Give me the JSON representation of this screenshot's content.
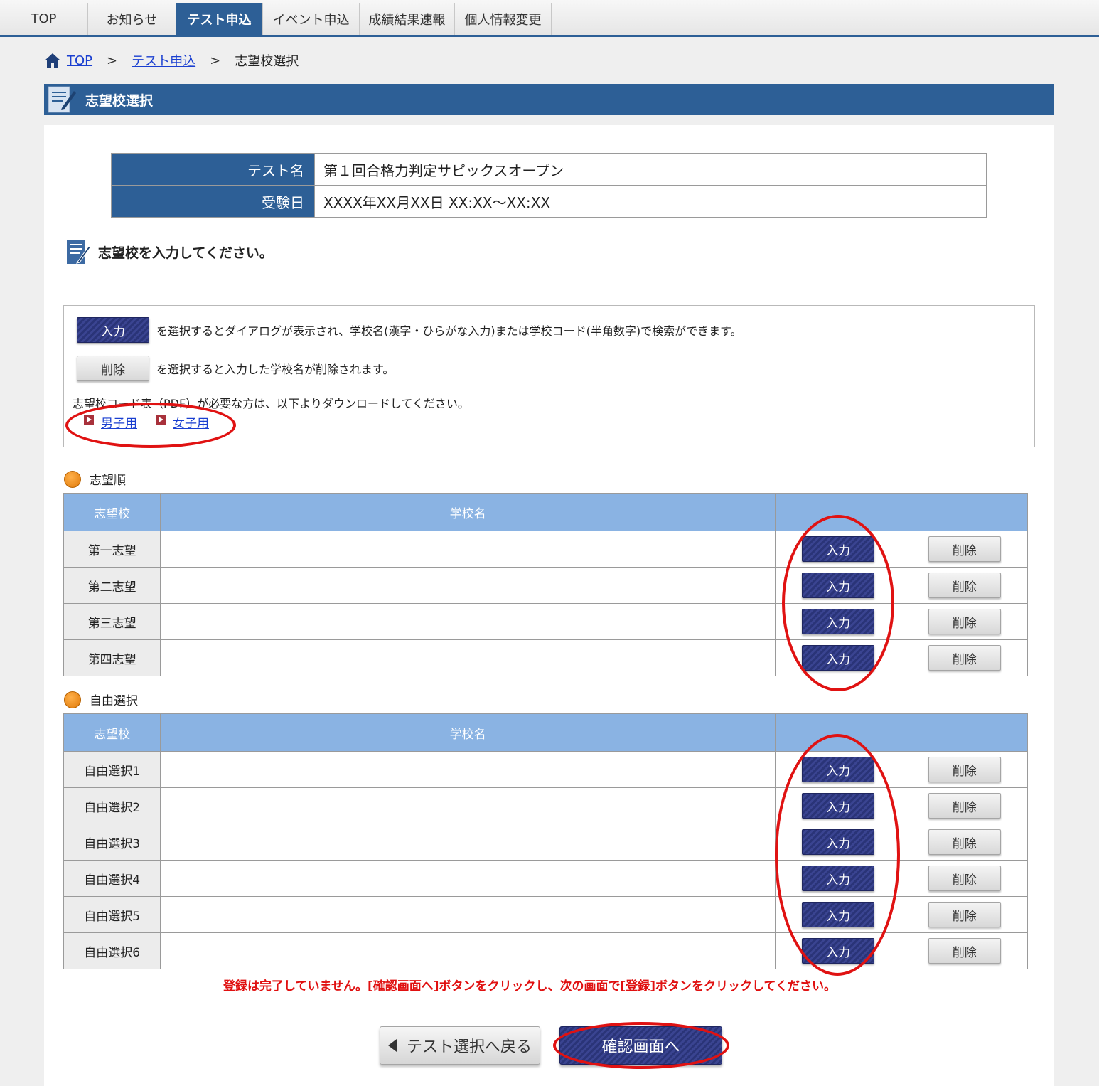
{
  "nav": {
    "tabs": [
      {
        "label": "TOP"
      },
      {
        "label": "お知らせ"
      },
      {
        "label": "テスト申込"
      },
      {
        "label": "イベント申込"
      },
      {
        "label": "成績結果速報"
      },
      {
        "label": "個人情報変更"
      }
    ],
    "active_tab": "テスト申込"
  },
  "breadcrumb": {
    "home": "TOP",
    "sep": ">",
    "parent": "テスト申込",
    "current": "志望校選択"
  },
  "section_title": "志望校選択",
  "test_info": {
    "name_label": "テスト名",
    "name_value": "第１回合格力判定サピックスオープン",
    "date_label": "受験日",
    "date_value": "XXXX年XX月XX日 XX:XX～XX:XX"
  },
  "prompt": "志望校を入力してください。",
  "instructions": {
    "input_btn": "入力",
    "input_text": "を選択するとダイアログが表示され、学校名(漢字・ひらがな入力)または学校コード(半角数字)で検索ができます。",
    "delete_btn": "削除",
    "delete_text": "を選択すると入力した学校名が削除されます。",
    "download_text": "志望校コード表（PDF）が必要な方は、以下よりダウンロードしてください。",
    "link_boys": "男子用",
    "link_girls": "女子用"
  },
  "ranked": {
    "label": "志望順",
    "col_school": "志望校",
    "col_name": "学校名",
    "rows": [
      {
        "label": "第一志望",
        "name": ""
      },
      {
        "label": "第二志望",
        "name": ""
      },
      {
        "label": "第三志望",
        "name": ""
      },
      {
        "label": "第四志望",
        "name": ""
      }
    ]
  },
  "free": {
    "label": "自由選択",
    "col_school": "志望校",
    "col_name": "学校名",
    "rows": [
      {
        "label": "自由選択1",
        "name": ""
      },
      {
        "label": "自由選択2",
        "name": ""
      },
      {
        "label": "自由選択3",
        "name": ""
      },
      {
        "label": "自由選択4",
        "name": ""
      },
      {
        "label": "自由選択5",
        "name": ""
      },
      {
        "label": "自由選択6",
        "name": ""
      }
    ]
  },
  "buttons": {
    "input": "入力",
    "delete": "削除",
    "back": "テスト選択へ戻る",
    "confirm": "確認画面へ"
  },
  "warning": "登録は完了していません。[確認画面へ]ボタンをクリックし、次の画面で[登録]ボタンをクリックしてください。",
  "colors": {
    "brand": "#2d5f96",
    "header_light": "#8ab3e3",
    "button_dark": "#2a3478",
    "annotation": "#e01212",
    "warning": "#e01010"
  }
}
